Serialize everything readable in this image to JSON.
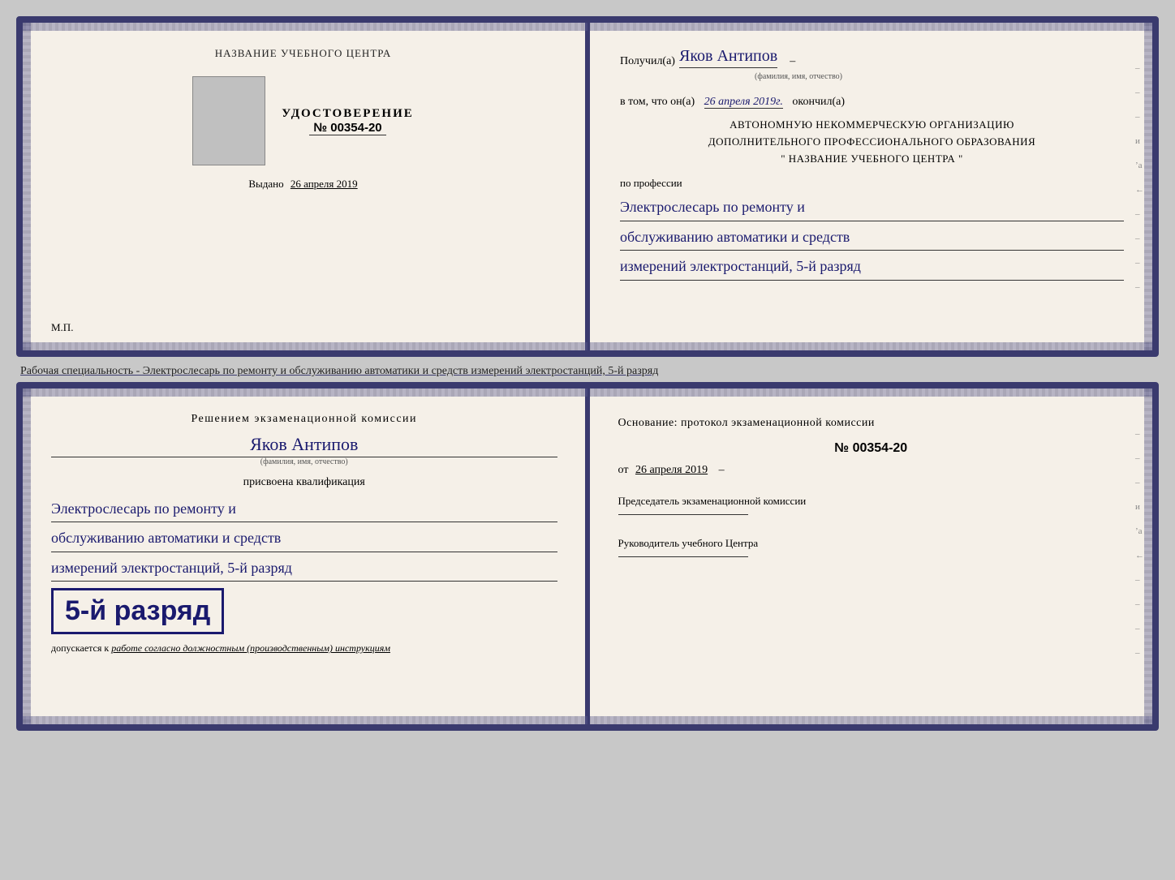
{
  "top_book": {
    "left": {
      "center_title": "НАЗВАНИЕ УЧЕБНОГО ЦЕНТРА",
      "udostoverenie_title": "УДОСТОВЕРЕНИЕ",
      "udostoverenie_number": "№ 00354-20",
      "vydano_prefix": "Выдано",
      "vydano_date": "26 апреля 2019",
      "mp": "М.П."
    },
    "right": {
      "poluchil_prefix": "Получил(а)",
      "recipient_name": "Яков Антипов",
      "recipient_name_note": "(фамилия, имя, отчество)",
      "vtom_prefix": "в том, что он(а)",
      "vtom_date": "26 апреля 2019г.",
      "okonchil": "окончил(а)",
      "org_line1": "АВТОНОМНУЮ НЕКОММЕРЧЕСКУЮ ОРГАНИЗАЦИЮ",
      "org_line2": "ДОПОЛНИТЕЛЬНОГО ПРОФЕССИОНАЛЬНОГО ОБРАЗОВАНИЯ",
      "org_line3": "\" НАЗВАНИЕ УЧЕБНОГО ЦЕНТРА \"",
      "po_professii": "по профессии",
      "profession_line1": "Электрослесарь по ремонту и",
      "profession_line2": "обслуживанию автоматики и средств",
      "profession_line3": "измерений электростанций, 5-й разряд",
      "side_marks": [
        "-",
        "-",
        "-",
        "и",
        "ʼа",
        "←",
        "-",
        "-",
        "-",
        "-"
      ]
    }
  },
  "middle_text": "Рабочая специальность - Электрослесарь по ремонту и обслуживанию автоматики и средств измерений электростанций, 5-й разряд",
  "bottom_book": {
    "left": {
      "reshenie_title": "Решением экзаменационной комиссии",
      "person_name": "Яков Антипов",
      "name_note": "(фамилия, имя, отчество)",
      "prisvoena": "присвоена квалификация",
      "profession_line1": "Электрослесарь по ремонту и",
      "profession_line2": "обслуживанию автоматики и средств",
      "profession_line3": "измерений электростанций, 5-й разряд",
      "rank_text": "5-й разряд",
      "dopuskaetsya_prefix": "допускается к",
      "dopuskaetsya_text": "работе согласно должностным (производственным) инструкциям"
    },
    "right": {
      "osnovanie_prefix": "Основание: протокол экзаменационной комиссии",
      "protocol_number": "№ 00354-20",
      "ot_prefix": "от",
      "ot_date": "26 апреля 2019",
      "predsedatel_title": "Председатель экзаменационной комиссии",
      "rukovoditel_title": "Руководитель учебного Центра",
      "side_marks": [
        "-",
        "-",
        "-",
        "и",
        "ʼа",
        "←",
        "-",
        "-",
        "-",
        "-"
      ]
    }
  }
}
